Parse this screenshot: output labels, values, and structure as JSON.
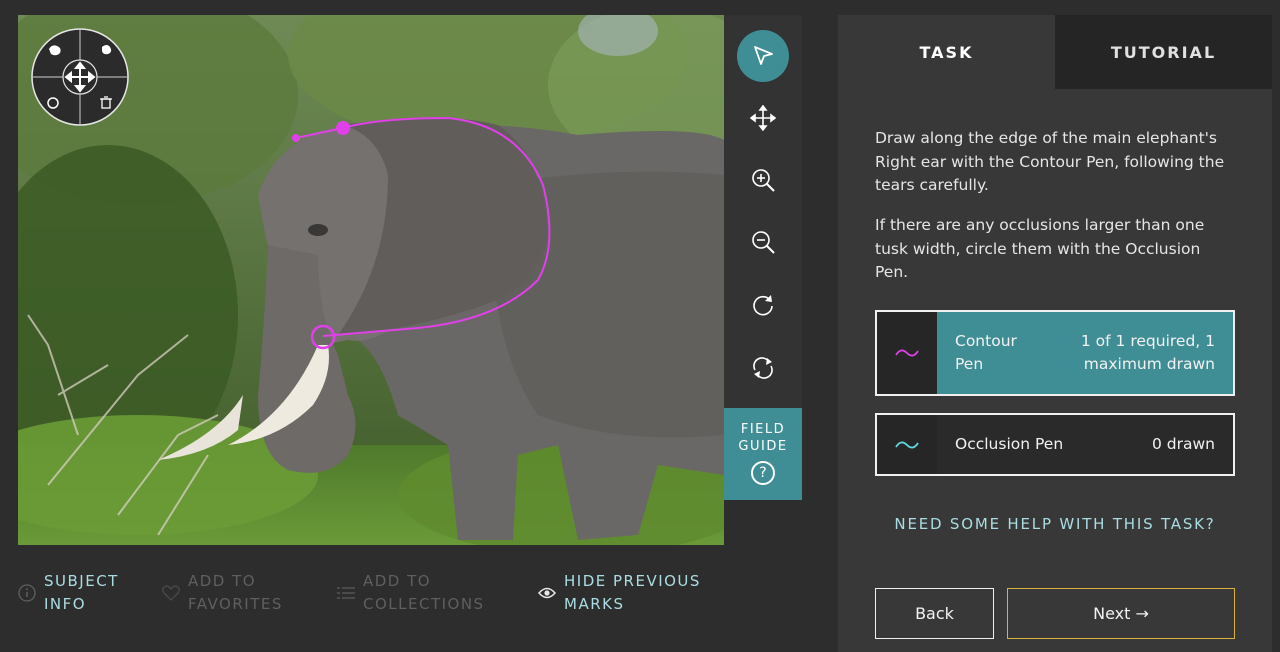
{
  "viewer": {
    "subject_alt": "African elephant standing in green bush"
  },
  "tools": [
    {
      "name": "pointer-icon",
      "active": true
    },
    {
      "name": "move-icon",
      "active": false
    },
    {
      "name": "zoom-in-icon",
      "active": false
    },
    {
      "name": "zoom-out-icon",
      "active": false
    },
    {
      "name": "rotate-icon",
      "active": false
    },
    {
      "name": "reset-icon",
      "active": false
    }
  ],
  "field_guide": {
    "line1": "FIELD",
    "line2": "GUIDE",
    "q": "?"
  },
  "meta": {
    "subject_info": "SUBJECT\nINFO",
    "favorites": "ADD TO\nFAVORITES",
    "collections": "ADD TO\nCOLLECTIONS",
    "hide_marks": "HIDE PREVIOUS\nMARKS"
  },
  "tabs": {
    "task": "TASK",
    "tutorial": "TUTORIAL"
  },
  "instructions": {
    "p1": "Draw along the edge of the main elephant's Right ear with the Contour Pen, following the tears carefully.",
    "p2": "If there are any occlusions larger than one tusk width, circle them with the Occlusion Pen."
  },
  "pens": [
    {
      "label": "Contour\nPen",
      "count": "1 of 1 required, 1\nmaximum drawn",
      "color": "#e040e8"
    },
    {
      "label": "Occlusion Pen",
      "count": "0 drawn",
      "color": "#5fd8e0"
    }
  ],
  "help": "NEED SOME HELP WITH THIS TASK?",
  "buttons": {
    "back": "Back",
    "next": "Next →"
  },
  "colors": {
    "accent": "#3f8e96",
    "mark": "#e040e8",
    "next_border": "#d9b23c"
  }
}
